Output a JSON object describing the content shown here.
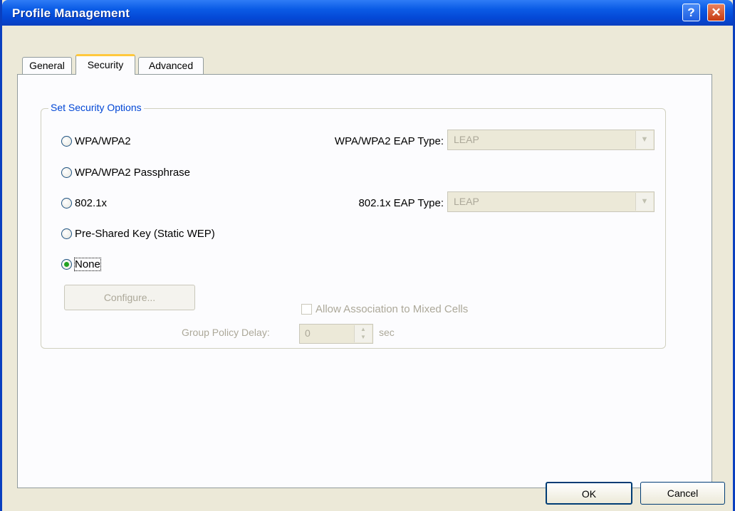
{
  "window": {
    "title": "Profile Management",
    "help_glyph": "?",
    "close_glyph": "✕"
  },
  "tabs": [
    {
      "label": "General",
      "selected": false
    },
    {
      "label": "Security",
      "selected": true
    },
    {
      "label": "Advanced",
      "selected": false
    }
  ],
  "security_group": {
    "legend": "Set Security Options",
    "options": [
      {
        "label": "WPA/WPA2",
        "checked": false
      },
      {
        "label": "WPA/WPA2 Passphrase",
        "checked": false
      },
      {
        "label": "802.1x",
        "checked": false
      },
      {
        "label": "Pre-Shared Key (Static WEP)",
        "checked": false
      },
      {
        "label": "None",
        "checked": true
      }
    ],
    "wpa_eap_type": {
      "label": "WPA/WPA2 EAP Type:",
      "value": "LEAP"
    },
    "dot1x_eap_type": {
      "label": "802.1x EAP Type:",
      "value": "LEAP"
    },
    "configure_button": "Configure...",
    "allow_mixed_cells": {
      "label": "Allow Association to Mixed Cells",
      "checked": false
    },
    "group_policy_delay": {
      "label": "Group Policy Delay:",
      "value": "0",
      "unit": "sec"
    }
  },
  "buttons": {
    "ok": "OK",
    "cancel": "Cancel"
  },
  "colors": {
    "titlebar": "#0b5ce6",
    "window_bg": "#ece9d8",
    "panel_bg": "#fcfcfe",
    "legend_text": "#0046d5",
    "disabled_text": "#aca899",
    "radio_dot": "#21a121"
  }
}
